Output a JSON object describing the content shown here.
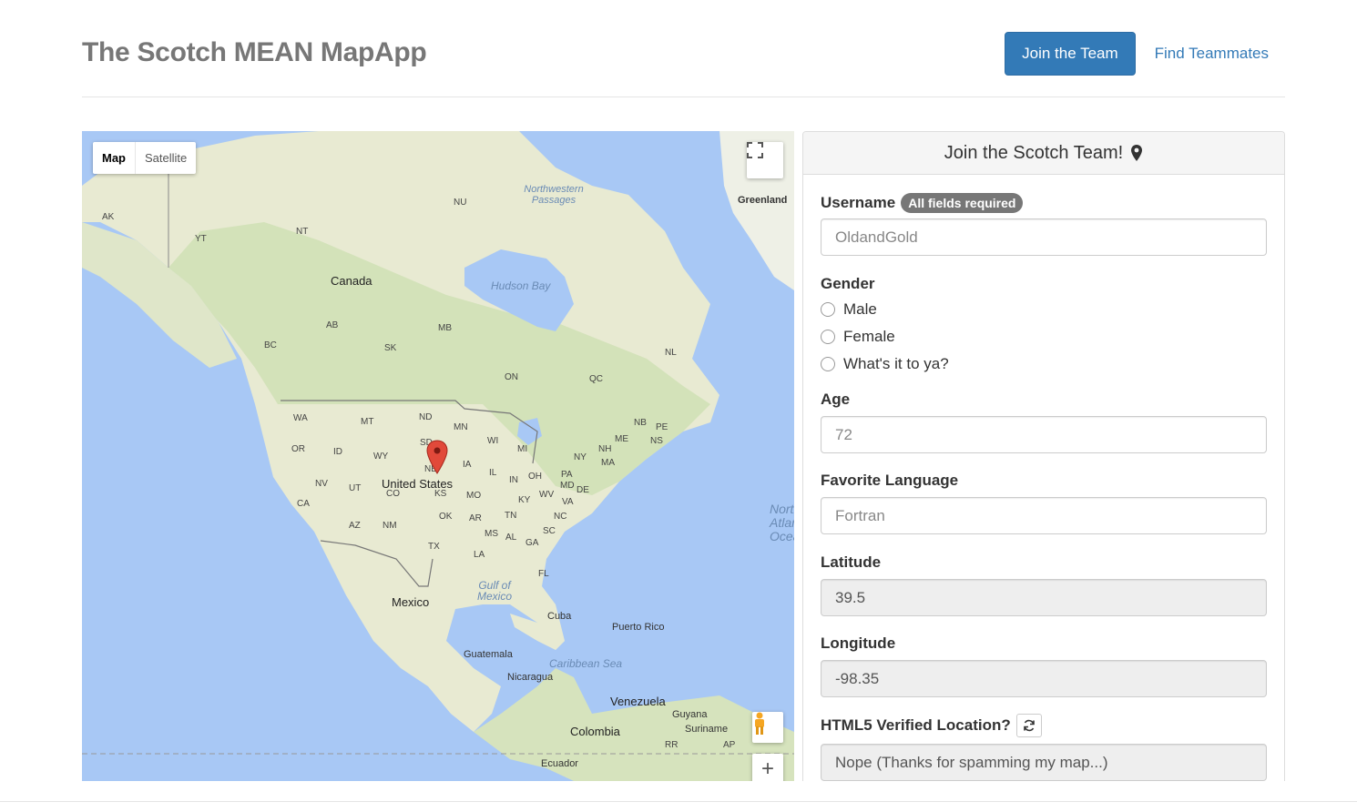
{
  "header": {
    "title": "The Scotch MEAN MapApp",
    "nav": {
      "join_label": "Join the Team",
      "find_label": "Find Teammates"
    }
  },
  "map": {
    "type_control": {
      "map_label": "Map",
      "satellite_label": "Satellite"
    },
    "labels": {
      "canada": "Canada",
      "united_states": "United States",
      "mexico": "Mexico",
      "greenland": "Greenland",
      "cuba": "Cuba",
      "puerto_rico": "Puerto Rico",
      "guatemala": "Guatemala",
      "nicaragua": "Nicaragua",
      "venezuela": "Venezuela",
      "colombia": "Colombia",
      "guyana": "Guyana",
      "suriname": "Suriname",
      "ecuador": "Ecuador",
      "hudson_bay": "Hudson Bay",
      "gulf_of_mexico": "Gulf of Mexico",
      "caribbean_sea": "Caribbean Sea",
      "northwestern_passages": "Northwestern Passages",
      "north_atlantic": "North Atlantic Ocean"
    },
    "state_labels": [
      "AK",
      "YT",
      "NT",
      "NU",
      "BC",
      "AB",
      "SK",
      "MB",
      "ON",
      "QC",
      "NL",
      "WA",
      "MT",
      "ND",
      "MN",
      "WI",
      "MI",
      "OR",
      "ID",
      "WY",
      "SD",
      "NE",
      "IA",
      "IL",
      "IN",
      "OH",
      "PA",
      "NY",
      "ME",
      "NH",
      "MA",
      "NB",
      "PE",
      "NS",
      "NV",
      "UT",
      "CO",
      "KS",
      "MO",
      "KY",
      "WV",
      "VA",
      "MD",
      "DE",
      "CA",
      "AZ",
      "NM",
      "OK",
      "AR",
      "TN",
      "NC",
      "MS",
      "AL",
      "GA",
      "SC",
      "TX",
      "LA",
      "FL",
      "RR",
      "AP"
    ],
    "marker": {
      "latitude": 39.5,
      "longitude": -98.35
    }
  },
  "form": {
    "title": "Join the Scotch Team!",
    "username": {
      "label": "Username",
      "badge": "All fields required",
      "value": "OldandGold"
    },
    "gender": {
      "label": "Gender",
      "options": [
        "Male",
        "Female",
        "What's it to ya?"
      ]
    },
    "age": {
      "label": "Age",
      "value": "72"
    },
    "language": {
      "label": "Favorite Language",
      "value": "Fortran"
    },
    "latitude": {
      "label": "Latitude",
      "value": "39.5"
    },
    "longitude": {
      "label": "Longitude",
      "value": "-98.35"
    },
    "html5": {
      "label": "HTML5 Verified Location?",
      "value": "Nope (Thanks for spamming my map...)"
    }
  },
  "colors": {
    "primary": "#337ab7",
    "water": "#a8c8f5",
    "land": "#e8ead2",
    "badge": "#777777",
    "marker": "#e1493a"
  },
  "icons": [
    "map-marker-icon",
    "refresh-icon",
    "fullscreen-icon",
    "pegman-icon",
    "plus-icon"
  ]
}
